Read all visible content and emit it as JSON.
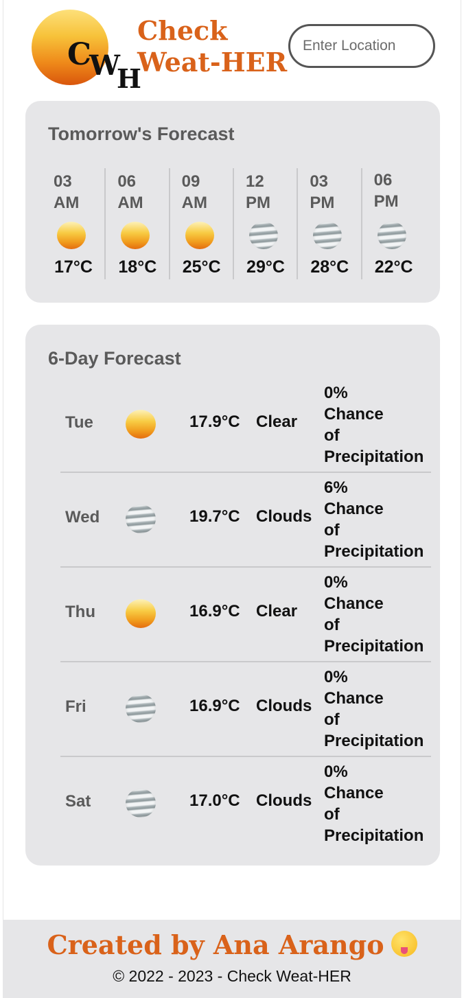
{
  "header": {
    "logo_letters": [
      "C",
      "W",
      "H"
    ],
    "brand_line1": "Check",
    "brand_line2": "Weat-HER",
    "search_placeholder": "Enter Location"
  },
  "tomorrow": {
    "title": "Tomorrow's Forecast",
    "hours": [
      {
        "time_line1": "03",
        "time_line2": "AM",
        "icon": "sun-icon",
        "temp": "17°C"
      },
      {
        "time_line1": "06",
        "time_line2": "AM",
        "icon": "sun-icon",
        "temp": "18°C"
      },
      {
        "time_line1": "09",
        "time_line2": "AM",
        "icon": "sun-icon",
        "temp": "25°C"
      },
      {
        "time_line1": "12",
        "time_line2": "PM",
        "icon": "cloud-icon",
        "temp": "29°C"
      },
      {
        "time_line1": "03",
        "time_line2": "PM",
        "icon": "cloud-icon",
        "temp": "28°C"
      },
      {
        "time_line1": "06",
        "time_line2": "PM",
        "icon": "cloud-icon",
        "temp": "22°C"
      }
    ]
  },
  "six_day": {
    "title": "6-Day Forecast",
    "days": [
      {
        "day": "Tue",
        "icon": "sun-icon",
        "temp": "17.9°C",
        "condition": "Clear",
        "precip_pct": "0%",
        "precip_l1": "Chance",
        "precip_l2": "of",
        "precip_l3": "Precipitation"
      },
      {
        "day": "Wed",
        "icon": "cloud-icon",
        "temp": "19.7°C",
        "condition": "Clouds",
        "precip_pct": "6%",
        "precip_l1": "Chance",
        "precip_l2": "of",
        "precip_l3": "Precipitation"
      },
      {
        "day": "Thu",
        "icon": "sun-icon",
        "temp": "16.9°C",
        "condition": "Clear",
        "precip_pct": "0%",
        "precip_l1": "Chance",
        "precip_l2": "of",
        "precip_l3": "Precipitation"
      },
      {
        "day": "Fri",
        "icon": "cloud-icon",
        "temp": "16.9°C",
        "condition": "Clouds",
        "precip_pct": "0%",
        "precip_l1": "Chance",
        "precip_l2": "of",
        "precip_l3": "Precipitation"
      },
      {
        "day": "Sat",
        "icon": "cloud-icon",
        "temp": "17.0°C",
        "condition": "Clouds",
        "precip_pct": "0%",
        "precip_l1": "Chance",
        "precip_l2": "of",
        "precip_l3": "Precipitation"
      }
    ]
  },
  "footer": {
    "credit": "Created by Ana Arango",
    "emoji_icon": "zany-face-icon",
    "copyright": "© 2022 - 2023 - Check Weat-HER"
  },
  "colors": {
    "brand": "#d9621a",
    "card_bg": "#e6e6e8",
    "label_gray": "#5a5a5a"
  }
}
